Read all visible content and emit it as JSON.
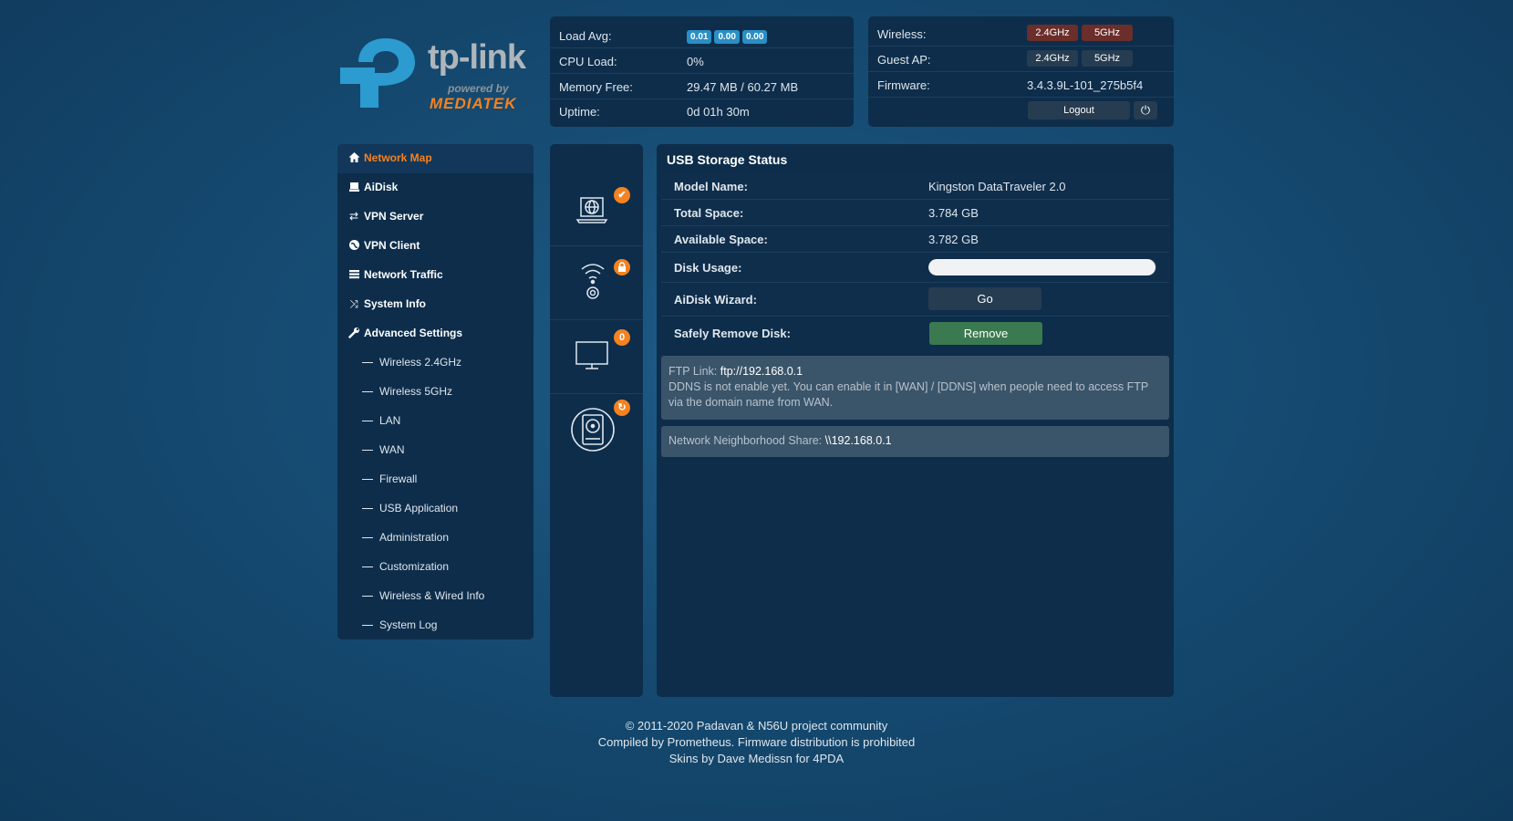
{
  "logo": {
    "brand": "tp-link",
    "powered": "powered by",
    "chip": "MEDIATEK"
  },
  "system": {
    "load_avg_label": "Load Avg:",
    "load_avg": [
      "0.01",
      "0.00",
      "0.00"
    ],
    "cpu_label": "CPU Load:",
    "cpu_value": "0%",
    "memory_label": "Memory Free:",
    "memory_value": "29.47 MB / 60.27 MB",
    "uptime_label": "Uptime:",
    "uptime_value": "0d 01h 30m"
  },
  "radio": {
    "wireless_label": "Wireless:",
    "wireless_bands": [
      "2.4GHz",
      "5GHz"
    ],
    "guest_label": "Guest AP:",
    "guest_bands": [
      "2.4GHz",
      "5GHz"
    ],
    "firmware_label": "Firmware:",
    "firmware_value": "3.4.3.9L-101_275b5f4",
    "logout_label": "Logout",
    "power_icon": "power-icon"
  },
  "sidebar": {
    "items": [
      {
        "label": "Network Map",
        "icon": "home-icon",
        "active": true
      },
      {
        "label": "AiDisk",
        "icon": "disk-icon"
      },
      {
        "label": "VPN Server",
        "icon": "vpn-server-icon"
      },
      {
        "label": "VPN Client",
        "icon": "globe-icon"
      },
      {
        "label": "Network Traffic",
        "icon": "list-icon"
      },
      {
        "label": "System Info",
        "icon": "shuffle-icon"
      },
      {
        "label": "Advanced Settings",
        "icon": "wrench-icon"
      }
    ],
    "sub_items": [
      "Wireless 2.4GHz",
      "Wireless 5GHz",
      "LAN",
      "WAN",
      "Firewall",
      "USB Application",
      "Administration",
      "Customization",
      "Wireless & Wired Info",
      "System Log"
    ]
  },
  "icons_column": {
    "cells": [
      {
        "icon": "internet-laptop-icon",
        "badge": "✔",
        "badge_icon": "check-icon"
      },
      {
        "icon": "wireless-router-icon",
        "badge": "🔒",
        "badge_icon": "lock-icon"
      },
      {
        "icon": "monitor-icon",
        "badge": "0",
        "badge_icon": "client-count"
      },
      {
        "icon": "hdd-icon",
        "badge": "↻",
        "badge_icon": "refresh-icon"
      }
    ]
  },
  "main": {
    "title": "USB Storage Status",
    "rows": {
      "model_label": "Model Name:",
      "model_value": "Kingston DataTraveler 2.0",
      "total_label": "Total Space:",
      "total_value": "3.784 GB",
      "available_label": "Available Space:",
      "available_value": "3.782 GB",
      "usage_label": "Disk Usage:",
      "usage_fraction": 0.997,
      "wizard_label": "AiDisk Wizard:",
      "wizard_button": "Go",
      "remove_label": "Safely Remove Disk:",
      "remove_button": "Remove"
    },
    "ftp": {
      "link_label": "FTP Link:",
      "link_value": "ftp://192.168.0.1",
      "ddns_note": "DDNS is not enable yet. You can enable it in [WAN] / [DDNS] when people need to access FTP via the domain name from WAN."
    },
    "share": {
      "label": "Network Neighborhood Share:",
      "value": "\\\\192.168.0.1"
    }
  },
  "footer": {
    "line1": "© 2011-2020 Padavan & N56U project community",
    "line2": "Compiled by Prometheus. Firmware distribution is prohibited",
    "line3": "Skins by Dave Medissn for 4PDA"
  },
  "colors": {
    "accent": "#f58220",
    "panel": "#0d2d4b",
    "badge_blue": "#2a8fc4",
    "remove_green": "#3b7a50"
  }
}
